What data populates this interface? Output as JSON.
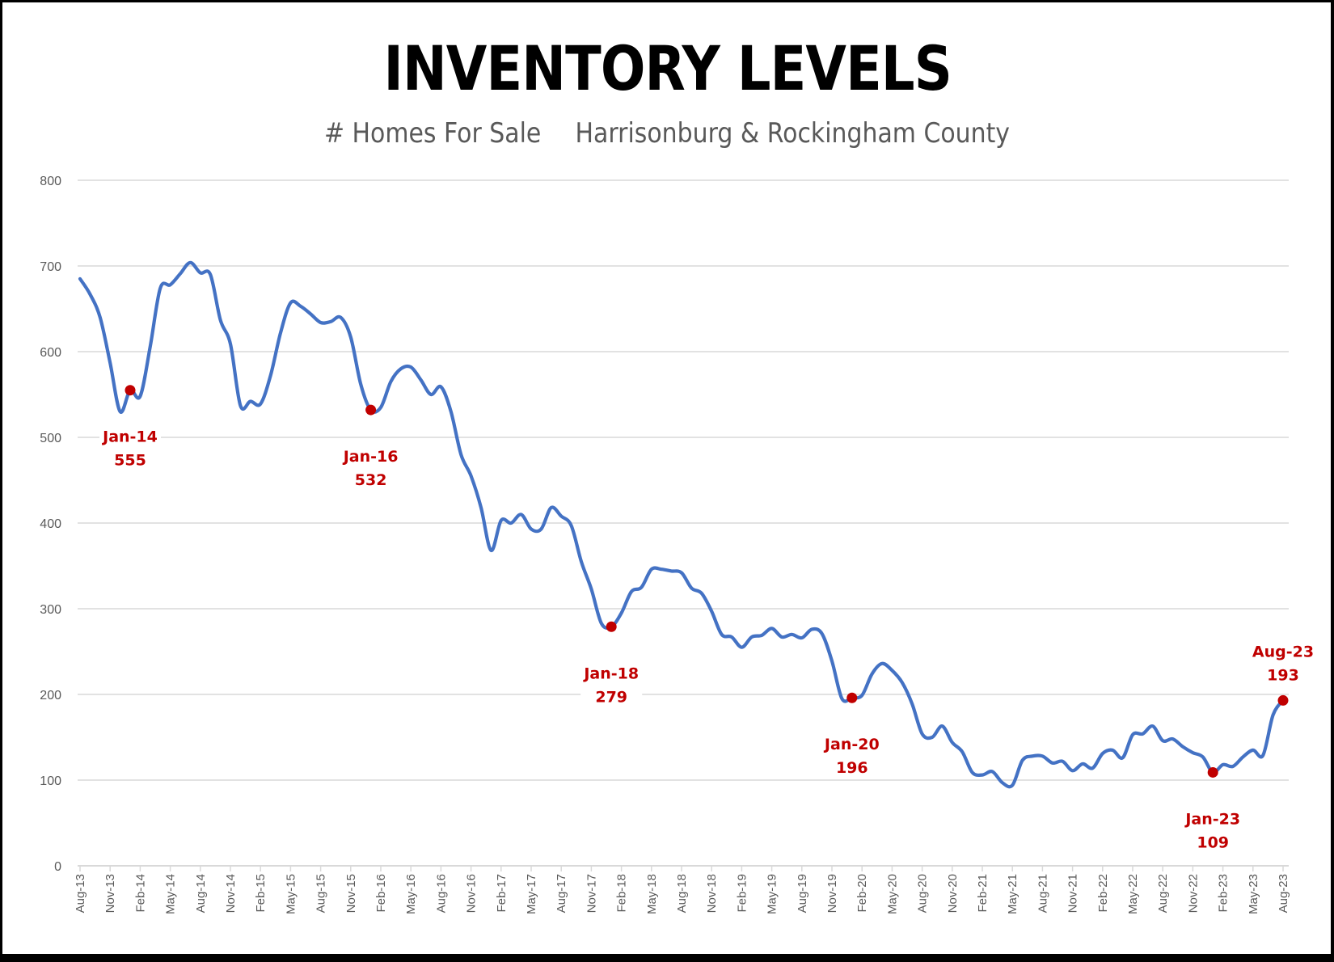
{
  "chart_data": {
    "type": "line",
    "title": "INVENTORY LEVELS",
    "subtitle_left": "# Homes For Sale",
    "subtitle_right": "Harrisonburg & Rockingham County",
    "xlabel": "",
    "ylabel": "",
    "ylim": [
      0,
      800
    ],
    "yticks": [
      0,
      100,
      200,
      300,
      400,
      500,
      600,
      700,
      800
    ],
    "grid": true,
    "legend": "none",
    "x_start": "Aug-13",
    "x_end": "Aug-23",
    "xtick_labels": [
      "Aug-13",
      "Nov-13",
      "Feb-14",
      "May-14",
      "Aug-14",
      "Nov-14",
      "Feb-15",
      "May-15",
      "Aug-15",
      "Nov-15",
      "Feb-16",
      "May-16",
      "Aug-16",
      "Nov-16",
      "Feb-17",
      "May-17",
      "Aug-17",
      "Nov-17",
      "Feb-18",
      "May-18",
      "Aug-18",
      "Nov-18",
      "Feb-19",
      "May-19",
      "Aug-19",
      "Nov-19",
      "Feb-20",
      "May-20",
      "Aug-20",
      "Nov-20",
      "Feb-21",
      "May-21",
      "Aug-21",
      "Nov-21",
      "Feb-22",
      "May-22",
      "Aug-22",
      "Nov-22",
      "Feb-23",
      "May-23",
      "Aug-23"
    ],
    "series": [
      {
        "name": "# Homes For Sale",
        "color": "#4472C4",
        "x": [
          "Aug-13",
          "Sep-13",
          "Oct-13",
          "Nov-13",
          "Dec-13",
          "Jan-14",
          "Feb-14",
          "Mar-14",
          "Apr-14",
          "May-14",
          "Jun-14",
          "Jul-14",
          "Aug-14",
          "Sep-14",
          "Oct-14",
          "Nov-14",
          "Dec-14",
          "Jan-15",
          "Feb-15",
          "Mar-15",
          "Apr-15",
          "May-15",
          "Jun-15",
          "Jul-15",
          "Aug-15",
          "Sep-15",
          "Oct-15",
          "Nov-15",
          "Dec-15",
          "Jan-16",
          "Feb-16",
          "Mar-16",
          "Apr-16",
          "May-16",
          "Jun-16",
          "Jul-16",
          "Aug-16",
          "Sep-16",
          "Oct-16",
          "Nov-16",
          "Dec-16",
          "Jan-17",
          "Feb-17",
          "Mar-17",
          "Apr-17",
          "May-17",
          "Jun-17",
          "Jul-17",
          "Aug-17",
          "Sep-17",
          "Oct-17",
          "Nov-17",
          "Dec-17",
          "Jan-18",
          "Feb-18",
          "Mar-18",
          "Apr-18",
          "May-18",
          "Jun-18",
          "Jul-18",
          "Aug-18",
          "Sep-18",
          "Oct-18",
          "Nov-18",
          "Dec-18",
          "Jan-19",
          "Feb-19",
          "Mar-19",
          "Apr-19",
          "May-19",
          "Jun-19",
          "Jul-19",
          "Aug-19",
          "Sep-19",
          "Oct-19",
          "Nov-19",
          "Dec-19",
          "Jan-20",
          "Feb-20",
          "Mar-20",
          "Apr-20",
          "May-20",
          "Jun-20",
          "Jul-20",
          "Aug-20",
          "Sep-20",
          "Oct-20",
          "Nov-20",
          "Dec-20",
          "Jan-21",
          "Feb-21",
          "Mar-21",
          "Apr-21",
          "May-21",
          "Jun-21",
          "Jul-21",
          "Aug-21",
          "Sep-21",
          "Oct-21",
          "Nov-21",
          "Dec-21",
          "Jan-22",
          "Feb-22",
          "Mar-22",
          "Apr-22",
          "May-22",
          "Jun-22",
          "Jul-22",
          "Aug-22",
          "Sep-22",
          "Oct-22",
          "Nov-22",
          "Dec-22",
          "Jan-23",
          "Feb-23",
          "Mar-23",
          "Apr-23",
          "May-23",
          "Jun-23",
          "Jul-23",
          "Aug-23"
        ],
        "values": [
          685,
          667,
          640,
          587,
          530,
          555,
          548,
          606,
          674,
          678,
          691,
          704,
          692,
          690,
          637,
          609,
          537,
          542,
          539,
          572,
          622,
          657,
          653,
          644,
          634,
          635,
          640,
          617,
          562,
          532,
          535,
          565,
          580,
          582,
          567,
          550,
          559,
          530,
          480,
          455,
          418,
          368,
          403,
          400,
          410,
          393,
          393,
          418,
          408,
          397,
          355,
          323,
          283,
          279,
          295,
          320,
          325,
          346,
          346,
          344,
          342,
          324,
          318,
          297,
          270,
          267,
          255,
          267,
          269,
          277,
          267,
          270,
          266,
          276,
          271,
          239,
          195,
          196,
          199,
          224,
          236,
          228,
          214,
          189,
          154,
          150,
          163,
          144,
          133,
          109,
          106,
          110,
          97,
          94,
          123,
          128,
          128,
          120,
          122,
          111,
          119,
          114,
          131,
          135,
          126,
          153,
          154,
          163,
          146,
          148,
          139,
          132,
          127,
          109,
          118,
          116,
          127,
          135,
          129,
          176,
          193
        ]
      }
    ],
    "annotations": [
      {
        "x": "Jan-14",
        "label": "Jan-14",
        "value": 555,
        "position": "below"
      },
      {
        "x": "Jan-16",
        "label": "Jan-16",
        "value": 532,
        "position": "below"
      },
      {
        "x": "Jan-18",
        "label": "Jan-18",
        "value": 279,
        "position": "below"
      },
      {
        "x": "Jan-20",
        "label": "Jan-20",
        "value": 196,
        "position": "below"
      },
      {
        "x": "Jan-23",
        "label": "Jan-23",
        "value": 109,
        "position": "below"
      },
      {
        "x": "Aug-23",
        "label": "Aug-23",
        "value": 193,
        "position": "above"
      }
    ],
    "annotation_color": "#C00000"
  }
}
